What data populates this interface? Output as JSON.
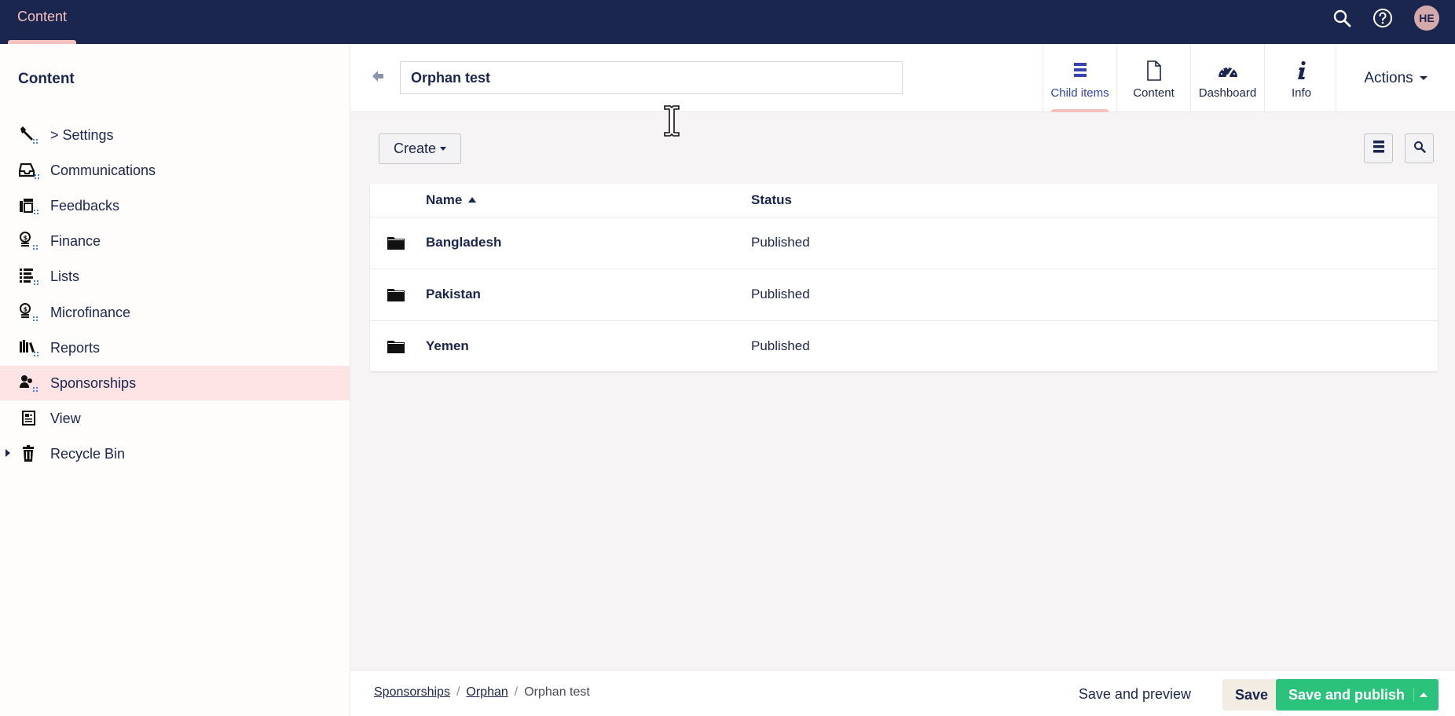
{
  "topbar": {
    "section_label": "Content",
    "avatar_initials": "HE",
    "icons": [
      "search-icon",
      "help-icon"
    ],
    "colors": {
      "bar": "#1b264f",
      "accent": "#f5c1bc"
    }
  },
  "sidebar": {
    "title": "Content",
    "items": [
      {
        "label": "> Settings",
        "icon": "wrench-icon"
      },
      {
        "label": "Communications",
        "icon": "inbox-icon"
      },
      {
        "label": "Feedbacks",
        "icon": "feedback-icon"
      },
      {
        "label": "Finance",
        "icon": "coins-icon"
      },
      {
        "label": "Lists",
        "icon": "list-icon"
      },
      {
        "label": "Microfinance",
        "icon": "coins-icon"
      },
      {
        "label": "Reports",
        "icon": "books-icon"
      },
      {
        "label": "Sponsorships",
        "icon": "users-icon",
        "active": true
      },
      {
        "label": "View",
        "icon": "document-icon"
      },
      {
        "label": "Recycle Bin",
        "icon": "trash-icon"
      }
    ]
  },
  "editor": {
    "name_value": "Orphan test",
    "apps": [
      {
        "label": "Child items",
        "icon": "list-icon",
        "active": true
      },
      {
        "label": "Content",
        "icon": "document-icon"
      },
      {
        "label": "Dashboard",
        "icon": "gauge-icon"
      },
      {
        "label": "Info",
        "icon": "info-icon"
      }
    ],
    "actions_label": "Actions"
  },
  "toolbar": {
    "create_label": "Create"
  },
  "table": {
    "headers": {
      "name": "Name",
      "status": "Status"
    },
    "rows": [
      {
        "name": "Bangladesh",
        "status": "Published"
      },
      {
        "name": "Pakistan",
        "status": "Published"
      },
      {
        "name": "Yemen",
        "status": "Published"
      }
    ]
  },
  "footer": {
    "breadcrumb": [
      "Sponsorships",
      "Orphan",
      "Orphan test"
    ],
    "save_preview_label": "Save and preview",
    "save_label": "Save",
    "publish_label": "Save and publish",
    "colors": {
      "publish": "#2bc37c",
      "save": "#f3ece3"
    }
  }
}
